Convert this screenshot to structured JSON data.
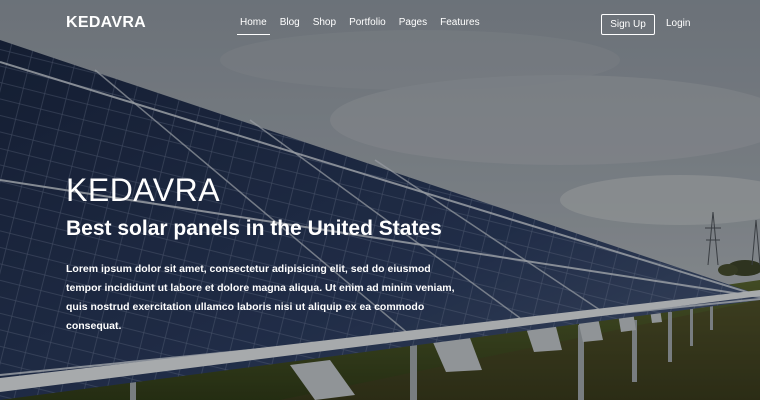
{
  "navbar": {
    "brand": "KEDAVRA",
    "links": [
      {
        "label": "Home",
        "active": true
      },
      {
        "label": "Blog",
        "active": false
      },
      {
        "label": "Shop",
        "active": false
      },
      {
        "label": "Portfolio",
        "active": false
      },
      {
        "label": "Pages",
        "active": false
      },
      {
        "label": "Features",
        "active": false
      }
    ],
    "signup_label": "Sign Up",
    "login_label": "Login"
  },
  "hero": {
    "title": "KEDAVRA",
    "subtitle": "Best solar panels in the United States",
    "text": "Lorem ipsum dolor sit amet, consectetur adipisicing elit, sed do eiusmod tempor incididunt ut labore et dolore magna aliqua. Ut enim ad minim veniam, quis nostrud exercitation ullamco laboris nisi ut aliquip ex ea commodo consequat."
  },
  "colors": {
    "text": "#ffffff",
    "sky": "#7c8590",
    "panel": "#1c2a44",
    "grass": "#3c4a22"
  }
}
